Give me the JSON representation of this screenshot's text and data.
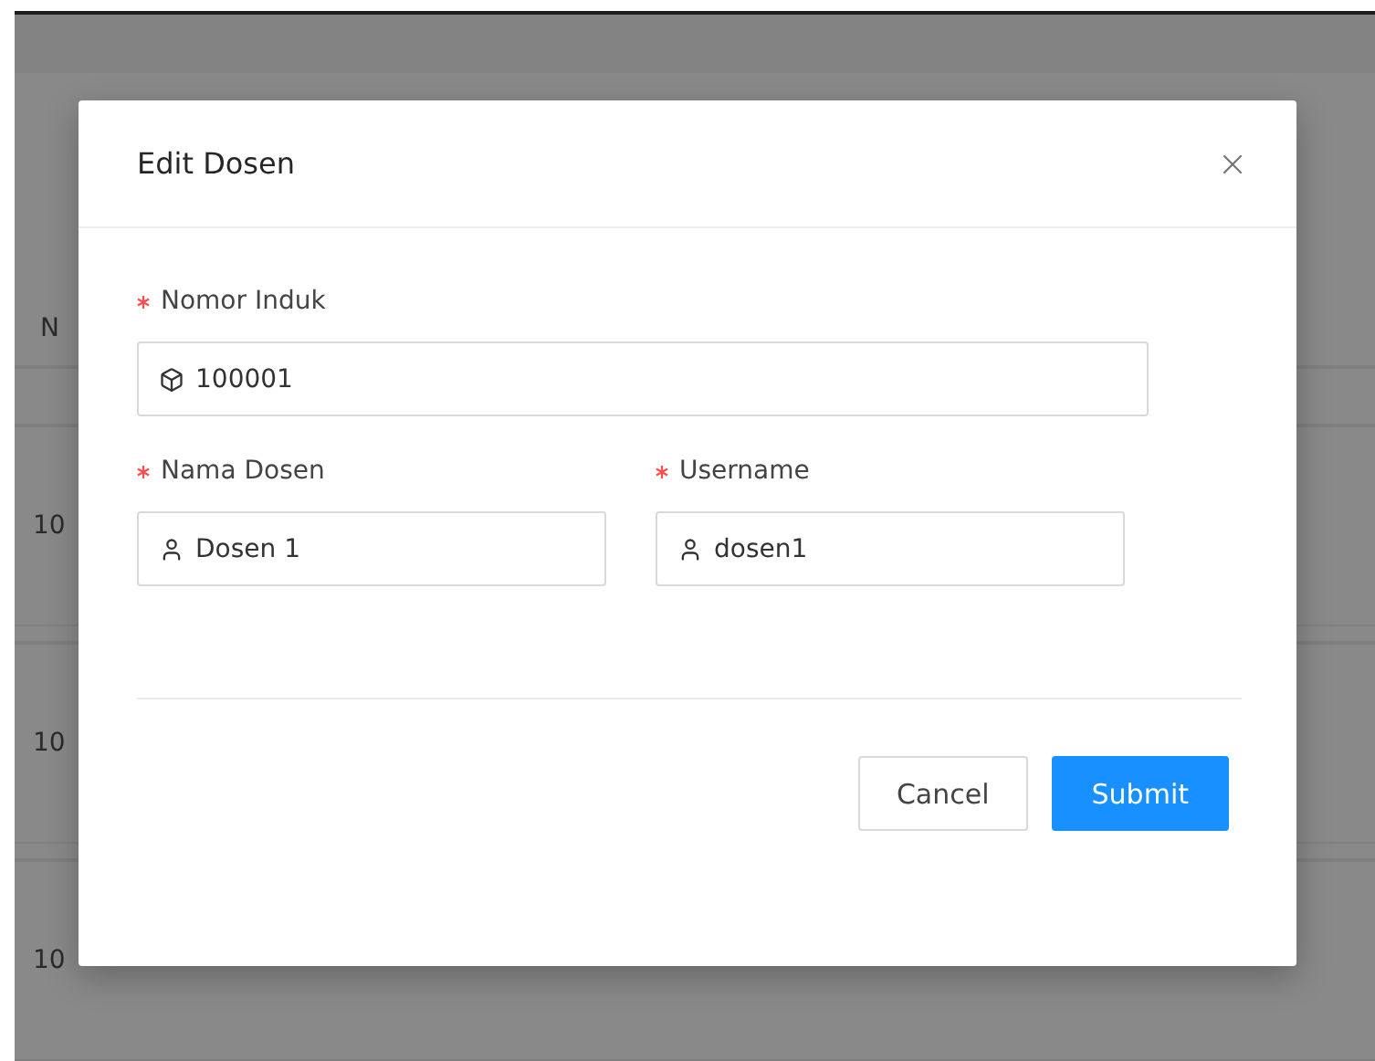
{
  "page": {
    "table": {
      "header": "N",
      "rows": [
        "10",
        "10",
        "10"
      ]
    }
  },
  "modal": {
    "title": "Edit Dosen",
    "rows": [
      [
        {
          "label": "Nomor Induk",
          "required": true,
          "value": "100001",
          "kind": "wide"
        }
      ],
      [
        {
          "label": "Nama Dosen",
          "required": true,
          "value": "Dosen 1",
          "kind": "half"
        },
        {
          "label": "Username",
          "required": true,
          "value": "dosen1",
          "kind": "half"
        }
      ]
    ],
    "buttons": [
      {
        "label": "Cancel",
        "kind": "default"
      },
      {
        "label": "Submit",
        "kind": "primary"
      }
    ]
  }
}
